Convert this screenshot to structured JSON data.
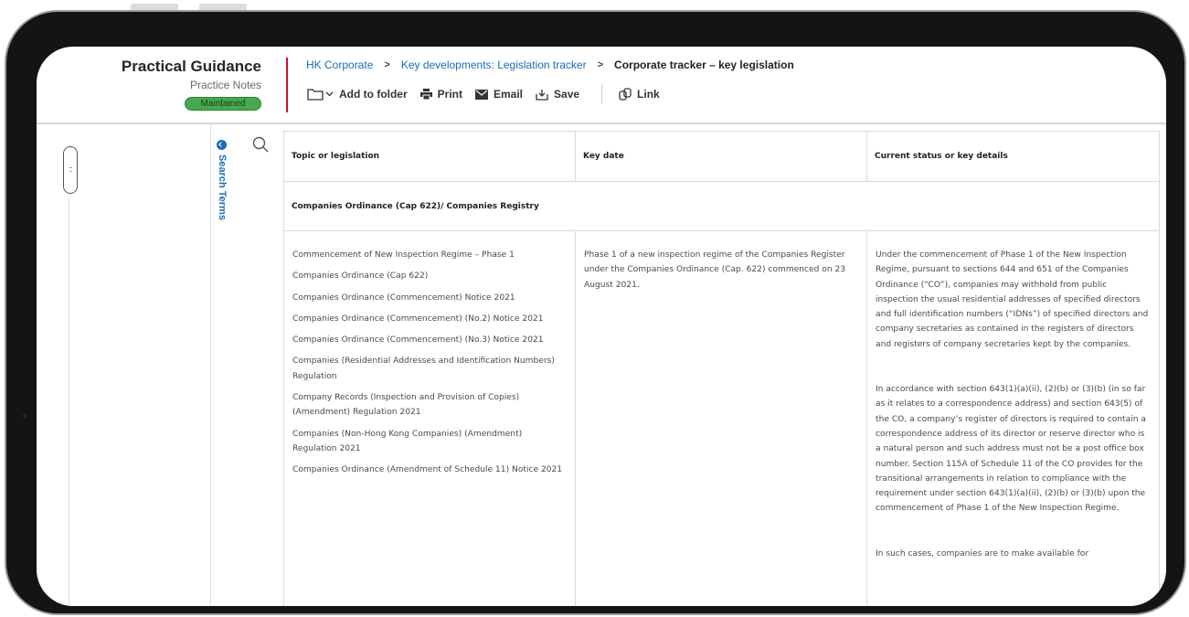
{
  "brand": {
    "title": "Practical Guidance",
    "subtitle": "Practice Notes",
    "badge": "Maintained"
  },
  "breadcrumb": {
    "items": [
      "HK Corporate",
      "Key developments: Legislation tracker"
    ],
    "current": "Corporate tracker – key legislation"
  },
  "toolbar": {
    "add_to_folder": "Add to folder",
    "print": "Print",
    "email": "Email",
    "save": "Save",
    "link": "Link"
  },
  "search_panel": {
    "label": "Search Terms"
  },
  "table": {
    "headers": [
      "Topic or legislation",
      "Key date",
      "Current status or key details"
    ],
    "section_title": "Companies Ordinance (Cap 622)/ Companies Registry",
    "legislation": [
      "Commencement of New Inspection Regime – Phase 1",
      "Companies Ordinance (Cap 622)",
      "Companies Ordinance (Commencement) Notice 2021",
      "Companies Ordinance (Commencement) (No.2) Notice 2021",
      "Companies Ordinance (Commencement) (No.3) Notice 2021",
      "Companies (Residential Addresses and Identification Numbers) Regulation",
      "Company Records (Inspection and Provision of Copies) (Amendment) Regulation 2021",
      "Companies (Non-Hong Kong Companies) (Amendment) Regulation 2021",
      "Companies Ordinance (Amendment of Schedule 11) Notice 2021"
    ],
    "key_date": "Phase 1 of a new inspection regime of the Companies Register under the Companies Ordinance (Cap. 622) commenced on 23 August 2021.",
    "status_paragraphs": [
      "Under the commencement of Phase 1 of the New Inspection Regime, pursuant to sections 644 and 651 of the Companies Ordinance (“CO”), companies may withhold from public inspection the usual residential addresses of specified directors and full identification numbers (“IDNs”) of specified directors and company secretaries as contained in the registers of directors and registers of company secretaries kept by the companies.",
      "In accordance with section 643(1)(a)(ii), (2)(b) or (3)(b) (in so far as it relates to a correspondence address) and section 643(5) of the CO, a company’s register of directors is required to contain a correspondence address of its director or reserve director who is a natural person and such address must not be a post office box number. Section 115A of Schedule 11 of the CO provides for the transitional arrangements in relation to compliance with the requirement under section 643(1)(a)(ii), (2)(b) or (3)(b) upon the commencement of Phase 1 of the New Inspection Regime.",
      "In such cases, companies are to make available for"
    ]
  },
  "colors": {
    "link": "#1a6bb5",
    "accent_rule": "#c8102e",
    "badge": "#47a94e"
  },
  "icons": [
    "folder-icon",
    "chevron-down-icon",
    "print-icon",
    "email-icon",
    "save-icon",
    "link-icon",
    "search-icon",
    "collapse-toggle-icon",
    "drag-handle-icon"
  ]
}
